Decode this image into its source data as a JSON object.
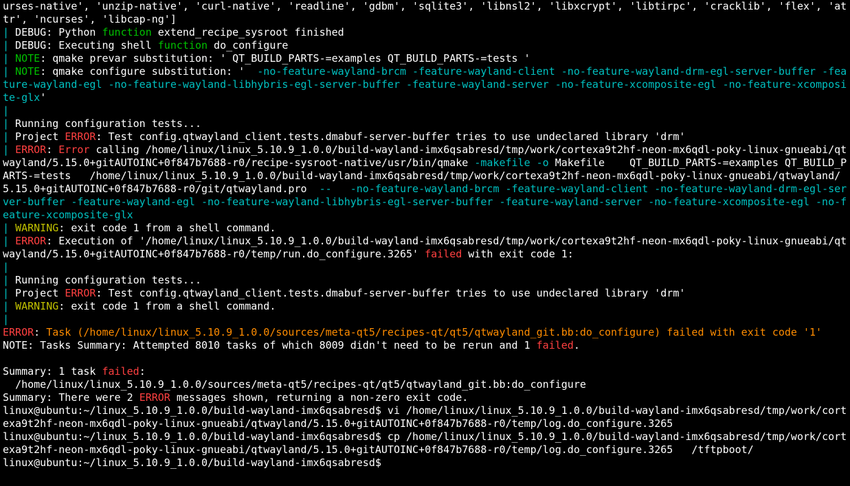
{
  "term": {
    "line0": "urses-native', 'unzip-native', 'curl-native', 'readline', 'gdbm', 'sqlite3', 'libnsl2', 'libxcrypt', 'libtirpc', 'cracklib', 'flex', 'attr', 'ncurses', 'libcap-ng']",
    "pipe": "|",
    "debug_py_a": " DEBUG: Python ",
    "kw_function": "function",
    "debug_py_b": " extend_recipe_sysroot finished",
    "debug_sh_a": " DEBUG: Executing shell ",
    "debug_sh_b": " do_configure",
    "note1_a": "NOTE",
    "note1_b": ": qmake prevar substitution: ' QT_BUILD_PARTS-=examples QT_BUILD_PARTS-=tests '",
    "note2_a": "NOTE",
    "note2_b": ": qmake configure substitution: '  ",
    "qtflags1": "-no-feature-wayland-brcm -feature-wayland-client -no-feature-wayland-drm-egl-server-buffer -feature-wayland-egl -no-feature-wayland-libhybris-egl-server-buffer -feature-wayland-server -no-feature-xcomposite-egl -no-feature-xcomposite-glx",
    "qtflags1_end": "'",
    "running_cfg": " Running configuration tests...",
    "proj_a": " Project ",
    "error_word": "ERROR",
    "warning_word": "WARNING",
    "proj_err1": ": Test config.qtwayland_client.tests.dmabuf-server-buffer tries to use undeclared library 'drm'",
    "err2_a": ": ",
    "err2_word": "Error",
    "err2_b": " calling /home/linux/linux_5.10.9_1.0.0/build-wayland-imx6qsabresd/tmp/work/cortexa9t2hf-neon-mx6qdl-poky-linux-gnueabi/qtwayland/5.15.0+gitAUTOINC+0f847b7688-r0/recipe-sysroot-native/usr/bin/qmake ",
    "makefile_o": "-makefile -o",
    "err2_c": " Makefile    QT_BUILD_PARTS-=examples QT_BUILD_PARTS-=tests   /home/linux/linux_5.10.9_1.0.0/build-wayland-imx6qsabresd/tmp/work/cortexa9t2hf-neon-mx6qdl-poky-linux-gnueabi/qtwayland/5.15.0+gitAUTOINC+0f847b7688-r0/git/qtwayland.pro  ",
    "dashdash": "--",
    "qtflags2": "   -no-feature-wayland-brcm -feature-wayland-client -no-feature-wayland-drm-egl-server-buffer -feature-wayland-egl -no-feature-wayland-libhybris-egl-server-buffer -feature-wayland-server -no-feature-xcomposite-egl -no-feature-xcomposite-glx",
    "warn_exit": ": exit code 1 from a shell command.",
    "err3_a": ": Execution of '/home/linux/linux_5.10.9_1.0.0/build-wayland-imx6qsabresd/tmp/work/cortexa9t2hf-neon-mx6qdl-poky-linux-gnueabi/qtwayland/5.15.0+gitAUTOINC+0f847b7688-r0/temp/run.do_configure.3265' ",
    "failed": "failed",
    "err3_b": " with exit code 1:",
    "final_err_a": ": ",
    "final_err_b": "Task (/home/linux/linux_5.10.9_1.0.0/sources/meta-qt5/recipes-qt/qt5/qtwayland_git.bb:do_configure) failed with exit code '1'",
    "note_tasks_a": "NOTE: Tasks Summary: Attempted 8010 tasks of which 8009 didn't need to be rerun and 1 ",
    "note_tasks_b": ".",
    "blank": "",
    "sum1_a": "Summary: 1 task ",
    "sum1_b": ":",
    "sum_path": "  /home/linux/linux_5.10.9_1.0.0/sources/meta-qt5/recipes-qt/qt5/qtwayland_git.bb:do_configure",
    "sum2_a": "Summary: There were 2 ",
    "sum2_b": " messages shown, returning a non-zero exit code.",
    "prompt": "linux@ubuntu:~/linux_5.10.9_1.0.0/build-wayland-imx6qsabresd$ ",
    "cmd_vi": "vi /home/linux/linux_5.10.9_1.0.0/build-wayland-imx6qsabresd/tmp/work/cortexa9t2hf-neon-mx6qdl-poky-linux-gnueabi/qtwayland/5.15.0+gitAUTOINC+0f847b7688-r0/temp/log.do_configure.3265",
    "cmd_cp": "cp /home/linux/linux_5.10.9_1.0.0/build-wayland-imx6qsabresd/tmp/work/cortexa9t2hf-neon-mx6qdl-poky-linux-gnueabi/qtwayland/5.15.0+gitAUTOINC+0f847b7688-r0/temp/log.do_configure.3265   /tftpboot/"
  }
}
